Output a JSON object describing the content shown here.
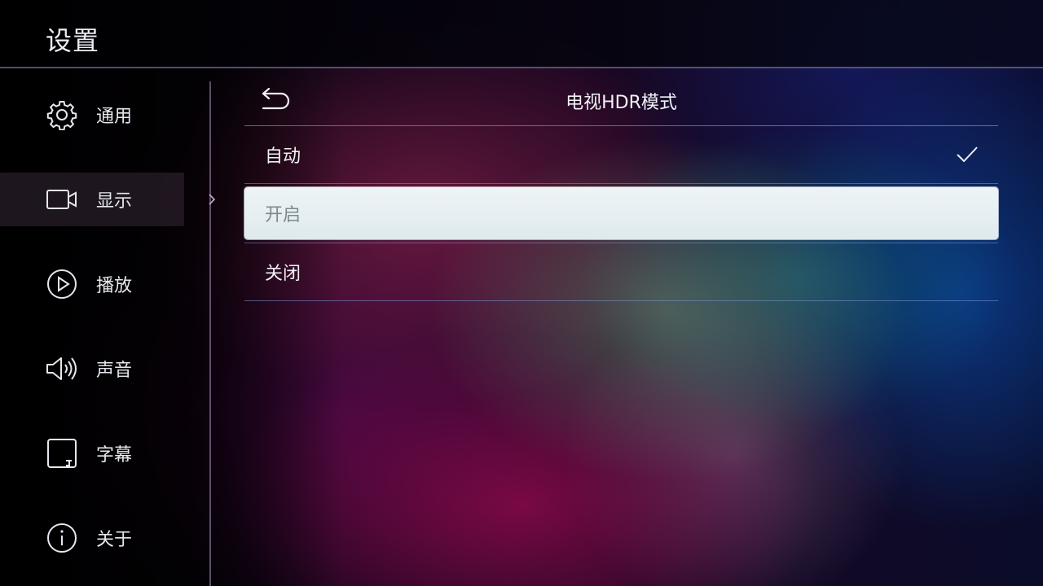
{
  "header": {
    "title": "设置"
  },
  "sidebar": {
    "items": [
      {
        "label": "通用",
        "icon": "gear-icon"
      },
      {
        "label": "显示",
        "icon": "display-icon",
        "selected": true
      },
      {
        "label": "播放",
        "icon": "play-icon"
      },
      {
        "label": "声音",
        "icon": "speaker-icon"
      },
      {
        "label": "字幕",
        "icon": "subtitle-icon"
      },
      {
        "label": "关于",
        "icon": "info-icon"
      }
    ]
  },
  "panel": {
    "title": "电视HDR模式",
    "back_icon": "back-arrow-icon",
    "options": [
      {
        "label": "自动",
        "checked": true
      },
      {
        "label": "开启",
        "focused": true
      },
      {
        "label": "关闭"
      }
    ]
  },
  "colors": {
    "focus_bg": "#e6eff2",
    "divider": "#7896d2",
    "text": "#f0f0f6"
  }
}
